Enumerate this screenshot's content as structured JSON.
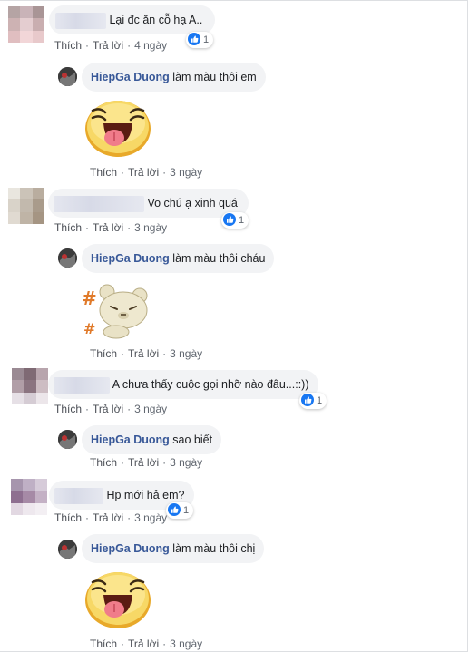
{
  "actions": {
    "like": "Thích",
    "reply": "Trả lời"
  },
  "comments": [
    {
      "text": "Lại đc ăn cỗ hạ A..",
      "time": "4 ngày",
      "reaction_count": "1",
      "reply": {
        "author": "HiepGa Duong",
        "text": "làm màu thôi em",
        "time": "3 ngày",
        "sticker": "laughing-face-sticker"
      }
    },
    {
      "text": "Vo chú ạ xinh quá",
      "time": "3 ngày",
      "reaction_count": "1",
      "reply": {
        "author": "HiepGa Duong",
        "text": "làm màu thôi cháu",
        "time": "3 ngày",
        "sticker": "angry-bear-sticker"
      }
    },
    {
      "text": "A chưa thấy cuộc gọi nhỡ nào đâu...::))",
      "time": "3 ngày",
      "reaction_count": "1",
      "reply": {
        "author": "HiepGa Duong",
        "text": "sao biết",
        "time": "3 ngày",
        "sticker": ""
      }
    },
    {
      "text": "Hp mới hả em?",
      "time": "3 ngày",
      "reaction_count": "1",
      "reply": {
        "author": "HiepGa Duong",
        "text": "làm màu thôi chị",
        "time": "3 ngày",
        "sticker": "laughing-face-sticker"
      }
    }
  ],
  "colors": {
    "name": "#385898",
    "bubble": "#f2f3f5",
    "like": "#1877f2"
  }
}
